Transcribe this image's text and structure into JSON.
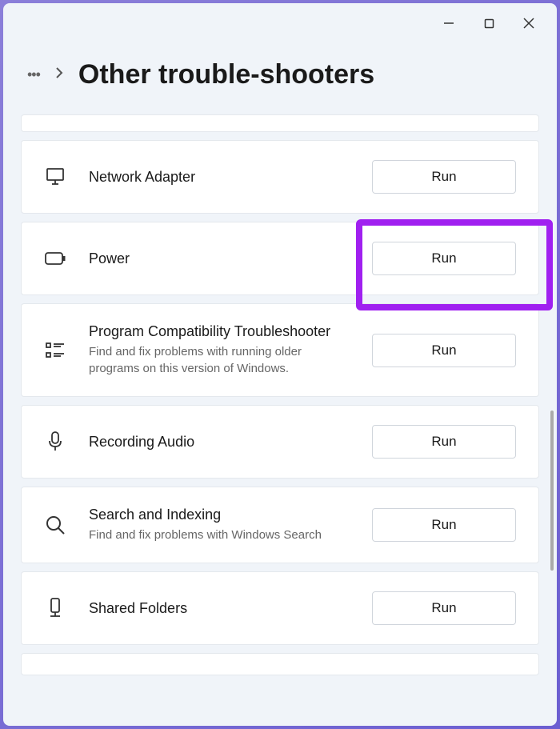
{
  "header": {
    "title": "Other trouble-shooters"
  },
  "items": [
    {
      "icon": "network-adapter-icon",
      "title": "Network Adapter",
      "button_label": "Run"
    },
    {
      "icon": "power-icon",
      "title": "Power",
      "button_label": "Run",
      "highlighted": true
    },
    {
      "icon": "program-compat-icon",
      "title": "Program Compatibility Troubleshooter",
      "description": "Find and fix problems with running older programs on this version of Windows.",
      "button_label": "Run"
    },
    {
      "icon": "microphone-icon",
      "title": "Recording Audio",
      "button_label": "Run"
    },
    {
      "icon": "search-icon",
      "title": "Search and Indexing",
      "description": "Find and fix problems with Windows Search",
      "button_label": "Run"
    },
    {
      "icon": "shared-folders-icon",
      "title": "Shared Folders",
      "button_label": "Run"
    }
  ]
}
